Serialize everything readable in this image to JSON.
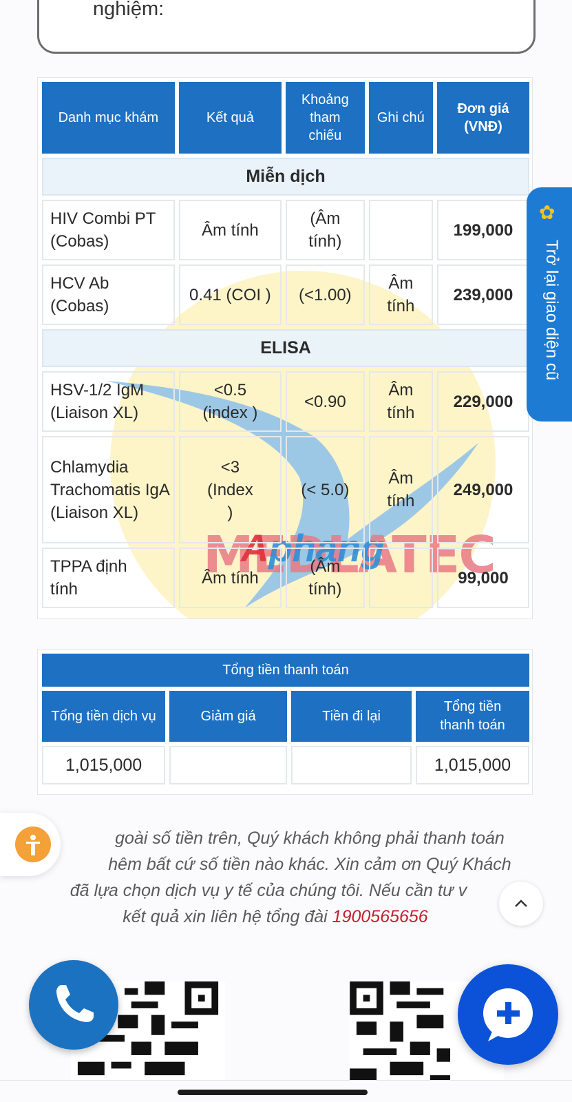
{
  "top_card": {
    "text": "nghiệm:"
  },
  "results_table": {
    "headers": [
      "Danh mục khám",
      "Kết quả",
      "Khoảng tham chiếu",
      "Ghi chú",
      "Đơn giá (VNĐ)"
    ],
    "sections": [
      {
        "title": "Miễn dịch",
        "rows": [
          {
            "name": "HIV Combi PT (Cobas)",
            "result": "Âm tính",
            "reference": "(Âm tính)",
            "note": "",
            "price": "199,000"
          },
          {
            "name": "HCV Ab (Cobas)",
            "result": "0.41 (COI )",
            "reference": "(<1.00)",
            "note": "Âm tính",
            "price": "239,000"
          }
        ]
      },
      {
        "title": "ELISA",
        "rows": [
          {
            "name": "HSV-1/2 IgM (Liaison XL)",
            "result": "<0.5 (index )",
            "reference": "<0.90",
            "note": "Âm tính",
            "price": "229,000"
          },
          {
            "name": "Chlamydia Trachomatis IgA (Liaison XL)",
            "result": "<3 (Index )",
            "reference": "(< 5.0)",
            "note": "Âm tính",
            "price": "249,000"
          },
          {
            "name": "TPPA định tính",
            "result": "Âm tính",
            "reference": "(Âm tính)",
            "note": "",
            "price": "99,000"
          }
        ]
      }
    ]
  },
  "watermark": {
    "brand": "Aphang",
    "logo": "MEDLATEC"
  },
  "totals_table": {
    "title": "Tổng tiền thanh toán",
    "headers": [
      "Tổng tiền dịch vụ",
      "Giảm giá",
      "Tiền đi lại",
      "Tổng tiền thanh toán"
    ],
    "values": [
      "1,015,000",
      "",
      "",
      "1,015,000"
    ]
  },
  "note": {
    "line1": "goài số tiền trên, Quý khách không phải thanh toán",
    "line2": "hêm bất cứ số tiền nào khác. Xin cảm ơn Quý Khách",
    "line3": "đã lựa chọn dịch vụ y tế của chúng tôi. Nếu cần tư v",
    "line4_prefix": "kết quả xin liên hệ tổng đài",
    "phone": "1900565656"
  },
  "side_tab": {
    "label": "Trở lại giao diện cũ"
  },
  "colors": {
    "header_blue": "#1d70c2",
    "accent_red": "#c21f2c",
    "chat_blue": "#0c52d8",
    "accessibility_orange": "#f4a13a"
  },
  "icons": [
    "gear-icon",
    "accessibility-icon",
    "chevron-up-icon",
    "phone-icon",
    "chat-plus-icon",
    "qr-code-icon"
  ]
}
